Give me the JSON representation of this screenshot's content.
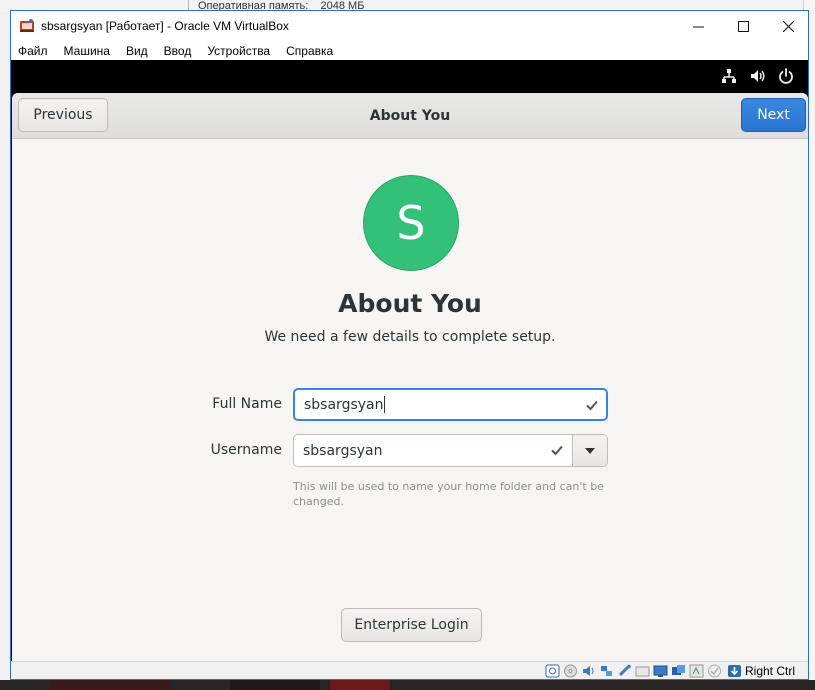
{
  "background": {
    "memory_label": "Оперативная память:",
    "memory_value": "2048 МБ"
  },
  "window": {
    "title": "sbsargsyan [Работает] - Oracle VM VirtualBox",
    "icon": "virtualbox-icon",
    "controls": [
      "minimize-icon",
      "maximize-icon",
      "close-icon"
    ]
  },
  "menu": {
    "items": [
      "Файл",
      "Машина",
      "Вид",
      "Ввод",
      "Устройства",
      "Справка"
    ]
  },
  "guest_topbar": {
    "icons": [
      "network-icon",
      "volume-icon",
      "power-icon"
    ]
  },
  "setup": {
    "previous_label": "Previous",
    "header_title": "About You",
    "next_label": "Next",
    "avatar_letter": "S",
    "avatar_color": "#33c17a",
    "heading": "About You",
    "subheading": "We need a few details to complete setup.",
    "full_name_label": "Full Name",
    "full_name_value": "sbsargsyan",
    "username_label": "Username",
    "username_value": "sbsargsyan",
    "username_hint": "This will be used to name your home folder and can't be changed.",
    "enterprise_label": "Enterprise Login",
    "accent_color": "#3584e4"
  },
  "statusbar": {
    "host_key": "Right Ctrl",
    "icons": [
      "hard-disk-icon",
      "optical-drive-icon",
      "audio-icon",
      "network-adapter-icon",
      "usb-icon",
      "shared-folders-icon",
      "display-icon",
      "video-capture-icon",
      "cpu-icon",
      "mouse-integration-icon",
      "keyboard-capture-icon"
    ]
  }
}
